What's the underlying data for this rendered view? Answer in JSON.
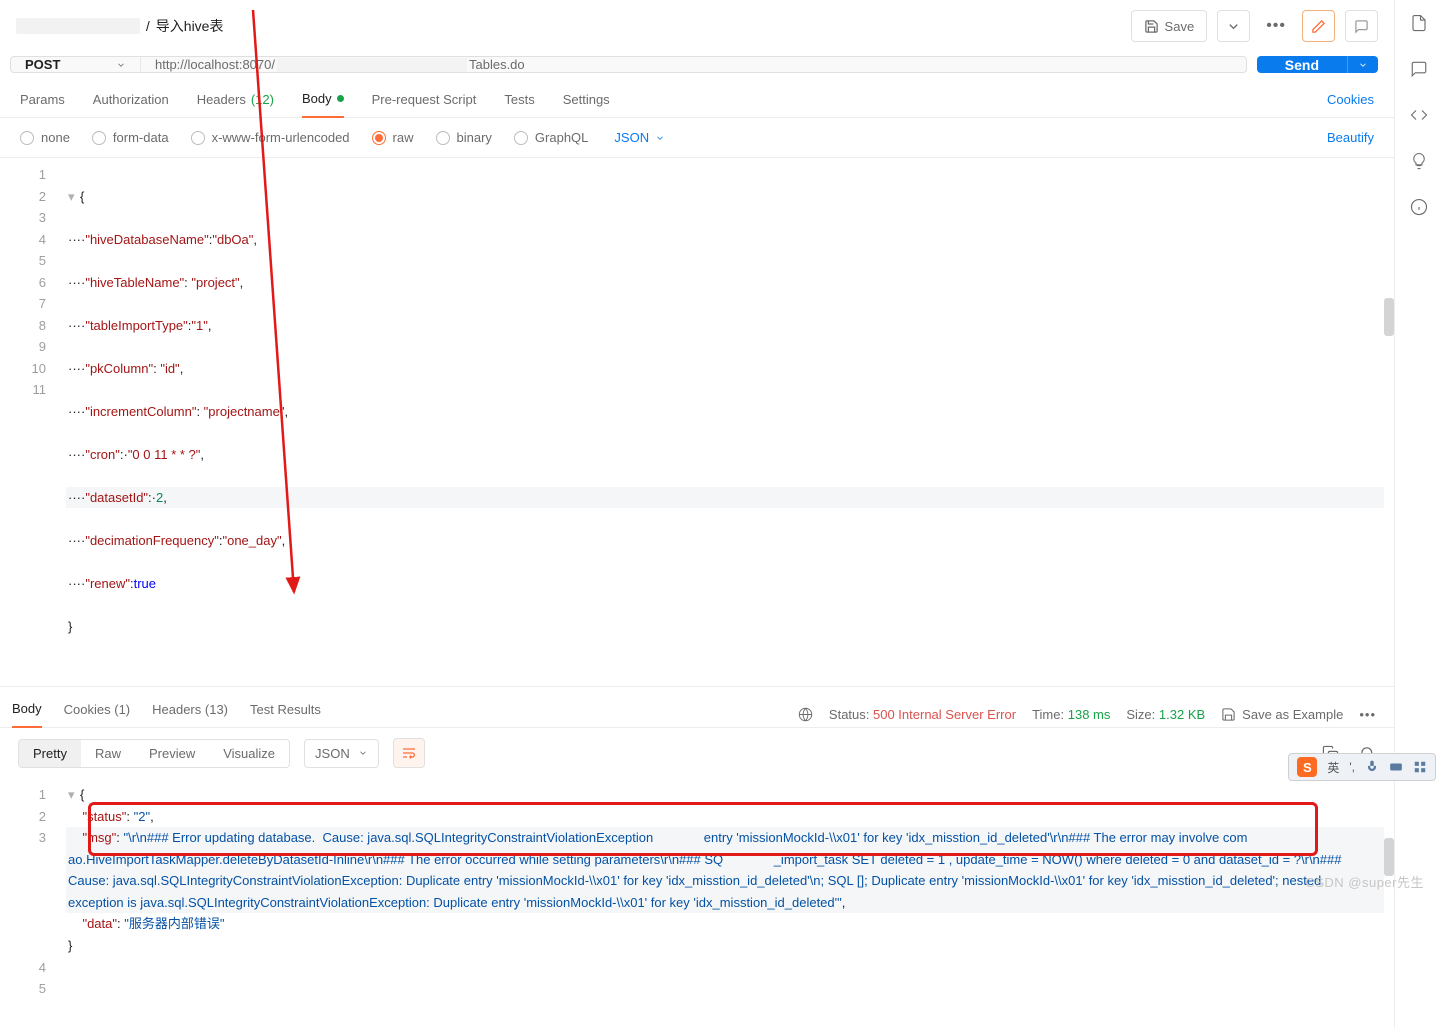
{
  "breadcrumb": {
    "redacted": "",
    "sep": "/",
    "title": "导入hive表"
  },
  "header_buttons": {
    "save": "Save"
  },
  "request": {
    "method": "POST",
    "url_prefix": "http://localhost:8070/",
    "url_suffix": "Tables.do"
  },
  "send": {
    "label": "Send"
  },
  "tabs": {
    "params": "Params",
    "authorization": "Authorization",
    "headers": "Headers",
    "headers_count": "(12)",
    "body": "Body",
    "prerequest": "Pre-request Script",
    "tests": "Tests",
    "settings": "Settings",
    "cookies": "Cookies"
  },
  "body_types": {
    "none": "none",
    "form_data": "form-data",
    "x_www": "x-www-form-urlencoded",
    "raw": "raw",
    "binary": "binary",
    "graphql": "GraphQL",
    "json": "JSON",
    "beautify": "Beautify"
  },
  "request_body": {
    "lines": [
      "1",
      "2",
      "3",
      "4",
      "5",
      "6",
      "7",
      "8",
      "9",
      "10",
      "11"
    ],
    "l1": "{",
    "l2_k": "\"hiveDatabaseName\"",
    "l2_v": "\"dbOa\"",
    "l3_k": "\"hiveTableName\"",
    "l3_v": "\"project\"",
    "l4_k": "\"tableImportType\"",
    "l4_v": "\"1\"",
    "l5_k": "\"pkColumn\"",
    "l5_v": "\"id\"",
    "l6_k": "\"incrementColumn\"",
    "l6_v": "\"projectname\"",
    "l7_k": "\"cron\"",
    "l7_v": "\"0 0 11 * * ?\"",
    "l8_k": "\"datasetId\"",
    "l8_v": "2",
    "l9_k": "\"decimationFrequency\"",
    "l9_v": "\"one_day\"",
    "l10_k": "\"renew\"",
    "l10_v": "true",
    "l11": "}"
  },
  "response_tabs": {
    "body": "Body",
    "cookies": "Cookies",
    "cookies_count": "(1)",
    "headers": "Headers",
    "headers_count": "(13)",
    "test_results": "Test Results",
    "status_label": "Status:",
    "status_value": "500 Internal Server Error",
    "time_label": "Time:",
    "time_value": "138 ms",
    "size_label": "Size:",
    "size_value": "1.32 KB",
    "save_example": "Save as Example"
  },
  "view_modes": {
    "pretty": "Pretty",
    "raw": "Raw",
    "preview": "Preview",
    "visualize": "Visualize",
    "json": "JSON"
  },
  "response_body": {
    "lines": [
      "1",
      "2",
      "3",
      "4",
      "5"
    ],
    "l1": "{",
    "l2_k": "\"status\"",
    "l2_v": "\"2\"",
    "l3_k": "\"msg\"",
    "l3_v": "\"\\r\\n### Error updating database.  Cause: java.sql.SQLIntegrityConstraintViolationException              entry 'missionMockId-\\\\x01' for key 'idx_misstion_id_deleted'\\r\\n### The error may involve com                              ao.HiveImportTaskMapper.deleteByDatasetId-Inline\\r\\n### The error occurred while setting parameters\\r\\n### SQ              _import_task SET deleted = 1 , update_time = NOW() where deleted = 0 and dataset_id = ?\\r\\n### Cause: java.sql.SQLIntegrityConstraintViolationException: Duplicate entry 'missionMockId-\\\\x01' for key 'idx_misstion_id_deleted'\\n; SQL []; Duplicate entry 'missionMockId-\\\\x01' for key 'idx_misstion_id_deleted'; nested exception is java.sql.SQLIntegrityConstraintViolationException: Duplicate entry 'missionMockId-\\\\x01' for key 'idx_misstion_id_deleted'\"",
    "l4_k": "\"data\"",
    "l4_v": "\"服务器内部错误\"",
    "l5": "}"
  },
  "ime": {
    "logo": "S",
    "lang": "英",
    "sep": "',"
  },
  "watermark": "CSDN @super先生"
}
